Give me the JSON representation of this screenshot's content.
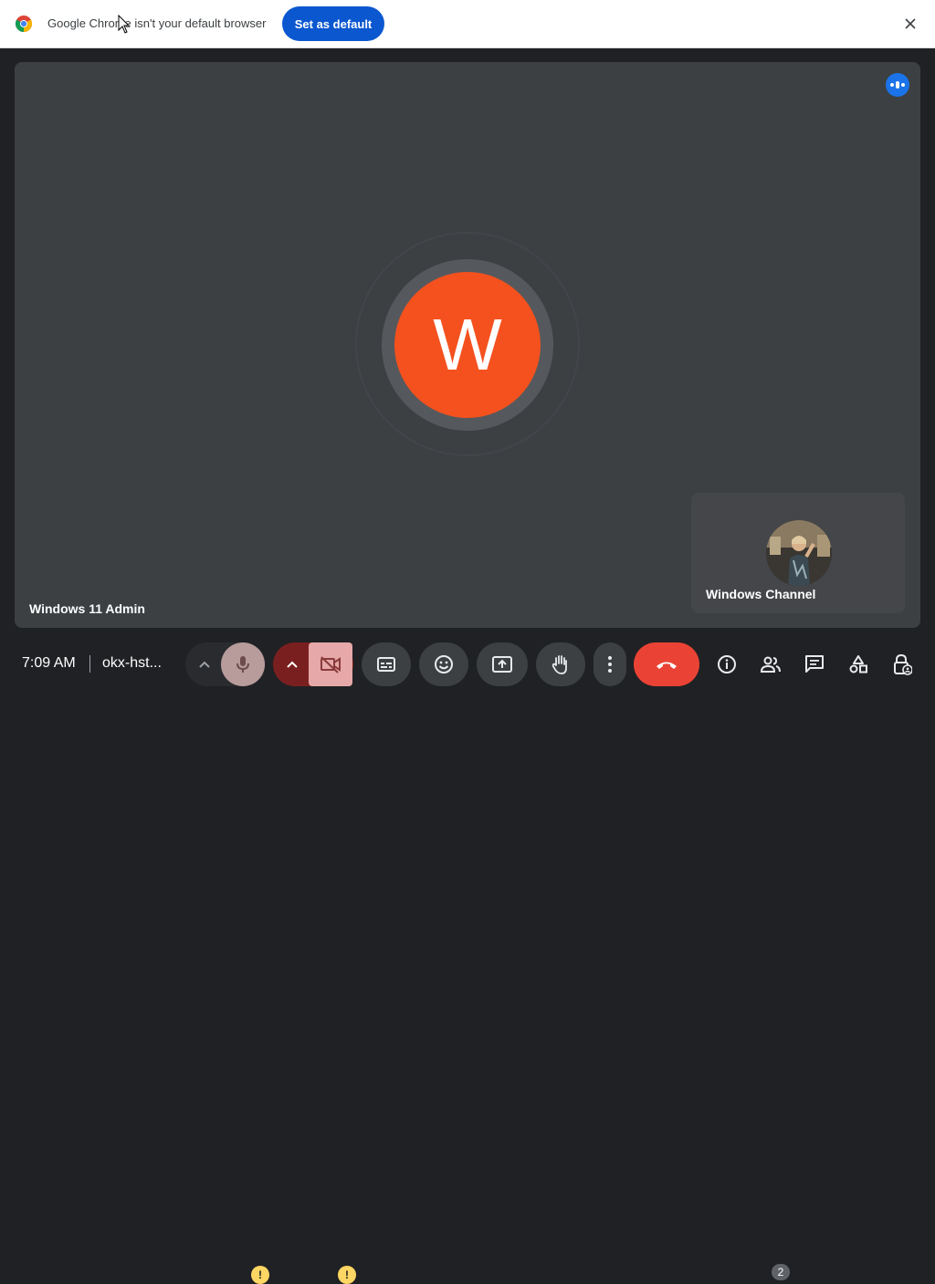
{
  "infobar": {
    "message": "Google Chrome isn't your default browser",
    "set_default_label": "Set as default",
    "icons": {
      "logo": "chrome-logo-icon",
      "close": "close-icon"
    }
  },
  "stage": {
    "main_participant": {
      "initial": "W",
      "name": "Windows 11 Admin",
      "avatar_color": "#f4511e"
    },
    "self_participant": {
      "name": "Windows Channel"
    }
  },
  "bottombar": {
    "time": "7:09 AM",
    "meeting_code": "okx-hst...",
    "participants_count": "2",
    "warning_glyph": "!",
    "colors": {
      "end_call": "#ea4335",
      "mic_off": "#b89c9c",
      "cam_off": "#e6a8a8",
      "warning": "#fdd663"
    }
  }
}
